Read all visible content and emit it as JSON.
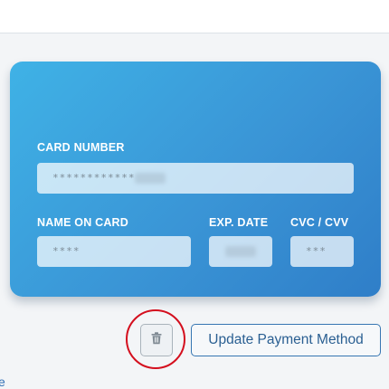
{
  "card": {
    "number_label": "CARD NUMBER",
    "number_value": "************",
    "name_label": "NAME ON CARD",
    "name_value": "****",
    "exp_label": "EXP. DATE",
    "cvc_label": "CVC / CVV",
    "cvc_value": "***"
  },
  "actions": {
    "update_label": "Update Payment Method",
    "delete_icon": "trash-icon"
  },
  "edge_link": "e",
  "colors": {
    "card_gradient_start": "#3fb2e6",
    "card_gradient_end": "#2f7ec8",
    "highlight_circle": "#d40f1e",
    "update_button_text": "#2a5f92"
  }
}
